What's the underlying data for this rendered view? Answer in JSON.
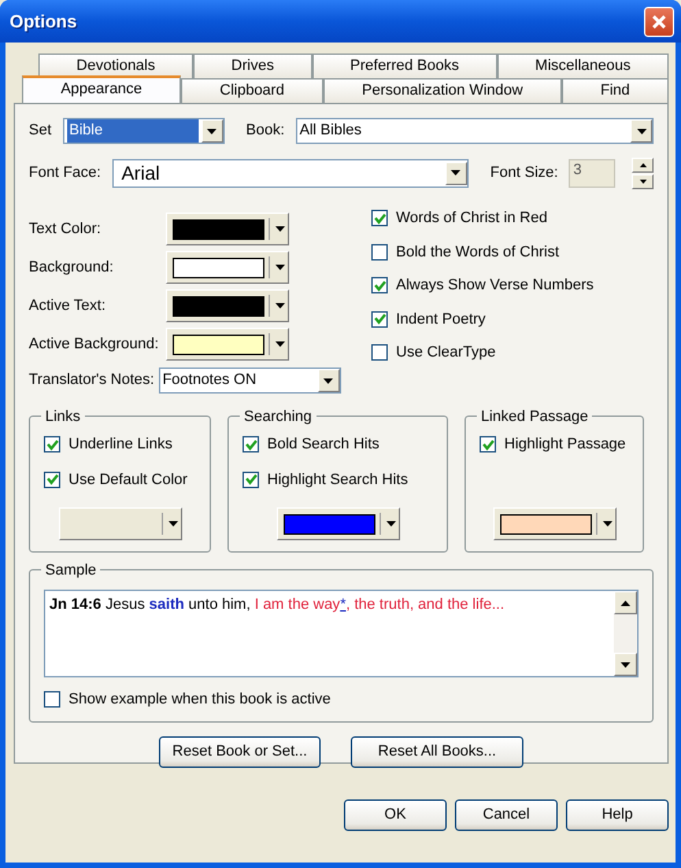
{
  "window": {
    "title": "Options"
  },
  "tab_rows": [
    [
      {
        "label": "Devotionals",
        "selected": false
      },
      {
        "label": "Drives",
        "selected": false
      },
      {
        "label": "Preferred Books",
        "selected": false
      },
      {
        "label": "Miscellaneous",
        "selected": false
      }
    ],
    [
      {
        "label": "Appearance",
        "selected": true
      },
      {
        "label": "Clipboard",
        "selected": false
      },
      {
        "label": "Personalization Window",
        "selected": false
      },
      {
        "label": "Find",
        "selected": false
      }
    ]
  ],
  "set": {
    "label": "Set",
    "value": "Bible"
  },
  "book": {
    "label": "Book:",
    "value": "All Bibles"
  },
  "font_face": {
    "label": "Font Face:",
    "value": "Arial"
  },
  "font_size": {
    "label": "Font Size:",
    "value": "3"
  },
  "colors": [
    {
      "label": "Text Color:",
      "color": "#000000"
    },
    {
      "label": "Background:",
      "color": "#ffffff"
    },
    {
      "label": "Active Text:",
      "color": "#000000"
    },
    {
      "label": "Active Background:",
      "color": "#ffffc0"
    }
  ],
  "options": [
    {
      "label": "Words of Christ in Red",
      "checked": true
    },
    {
      "label": "Bold the Words of Christ",
      "checked": false
    },
    {
      "label": "Always Show Verse Numbers",
      "checked": true
    },
    {
      "label": "Indent Poetry",
      "checked": true
    },
    {
      "label": "Use ClearType",
      "checked": false
    }
  ],
  "translators_notes": {
    "label": "Translator's Notes:",
    "value": "Footnotes ON"
  },
  "groups": [
    {
      "title": "Links",
      "options": [
        {
          "label": "Underline Links",
          "checked": true
        },
        {
          "label": "Use Default Color",
          "checked": true
        }
      ]
    },
    {
      "title": "Searching",
      "options": [
        {
          "label": "Bold Search Hits",
          "checked": true
        },
        {
          "label": "Highlight Search Hits",
          "checked": true
        }
      ],
      "color": "#0000ff"
    },
    {
      "title": "Linked Passage",
      "options": [
        {
          "label": "Highlight Passage",
          "checked": true
        }
      ],
      "color": "#ffd8b8"
    }
  ],
  "sample": {
    "title": "Sample",
    "segments": [
      {
        "kind": "ref",
        "text": "Jn 14:6"
      },
      {
        "kind": "plain",
        "text": " Jesus "
      },
      {
        "kind": "emph",
        "text": "saith"
      },
      {
        "kind": "plain",
        "text": " unto him, "
      },
      {
        "kind": "christ",
        "text": "I am the way"
      },
      {
        "kind": "footnote",
        "text": "*"
      },
      {
        "kind": "christ",
        "text": ", the truth, and the life..."
      }
    ],
    "show_example": {
      "label": "Show example when this book is active",
      "checked": false
    }
  },
  "reset_buttons": [
    "Reset Book or Set...",
    "Reset All Books..."
  ],
  "buttons": [
    "OK",
    "Cancel",
    "Help"
  ]
}
